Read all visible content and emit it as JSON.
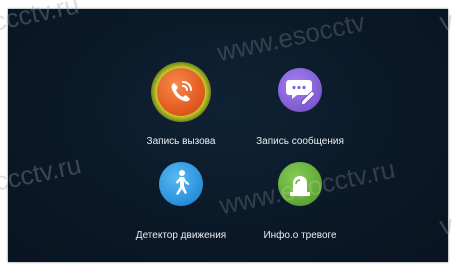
{
  "menu": {
    "items": [
      {
        "id": "call-record",
        "label": "Запись вызова",
        "icon": "phone-call-icon",
        "color": "#e8632a",
        "selected": true
      },
      {
        "id": "message-record",
        "label": "Запись сообщения",
        "icon": "message-pencil-icon",
        "color": "#8a63d8",
        "selected": false
      },
      {
        "id": "motion-detector",
        "label": "Детектор движения",
        "icon": "walking-person-icon",
        "color": "#2f9ee4",
        "selected": false
      },
      {
        "id": "alarm-info",
        "label": "Инфо.о тревоге",
        "icon": "alarm-siren-icon",
        "color": "#6db43f",
        "selected": false
      }
    ]
  },
  "watermarks": [
    "ccctv.ru",
    "www.esocctv",
    "v",
    "ccctv.ru",
    "www.esocctv.ru",
    "v"
  ]
}
